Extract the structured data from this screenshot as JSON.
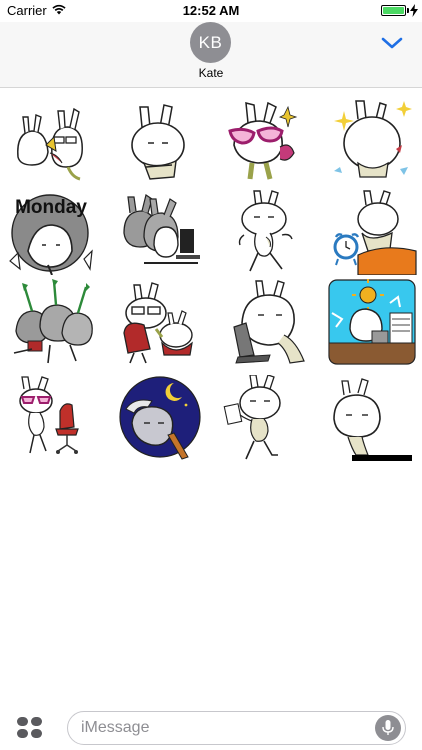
{
  "status_bar": {
    "carrier": "Carrier",
    "time": "12:52 AM",
    "battery_level": 1.0,
    "battery_color": "#4cd964"
  },
  "conversation": {
    "avatar_initials": "KB",
    "avatar_color": "#8e8e93",
    "contact_name": "Kate",
    "expand_icon": "chevron-down-icon",
    "accent_color": "#1f6fe5"
  },
  "sticker_pack": {
    "stickers": [
      {
        "name": "rabbit-pair-whisper",
        "caption": ""
      },
      {
        "name": "rabbit-arms-crossed",
        "caption": ""
      },
      {
        "name": "rabbit-pink-glasses",
        "caption": ""
      },
      {
        "name": "rabbit-sparkles",
        "caption": ""
      },
      {
        "name": "rabbit-monday",
        "caption": "Monday"
      },
      {
        "name": "rabbits-at-computer",
        "caption": ""
      },
      {
        "name": "rabbit-dancing",
        "caption": ""
      },
      {
        "name": "rabbit-alarm-clock",
        "caption": ""
      },
      {
        "name": "rabbits-arrows",
        "caption": ""
      },
      {
        "name": "rabbit-office-chair-pair",
        "caption": ""
      },
      {
        "name": "rabbit-laptop",
        "caption": ""
      },
      {
        "name": "rabbit-desk-papers",
        "caption": ""
      },
      {
        "name": "rabbit-red-chair",
        "caption": ""
      },
      {
        "name": "rabbit-moon-night",
        "caption": ""
      },
      {
        "name": "rabbit-walking-paper",
        "caption": ""
      },
      {
        "name": "rabbit-peeking",
        "caption": ""
      }
    ]
  },
  "input_bar": {
    "apps_icon": "app-drawer-icon",
    "placeholder": "iMessage",
    "mic_icon": "microphone-icon"
  }
}
